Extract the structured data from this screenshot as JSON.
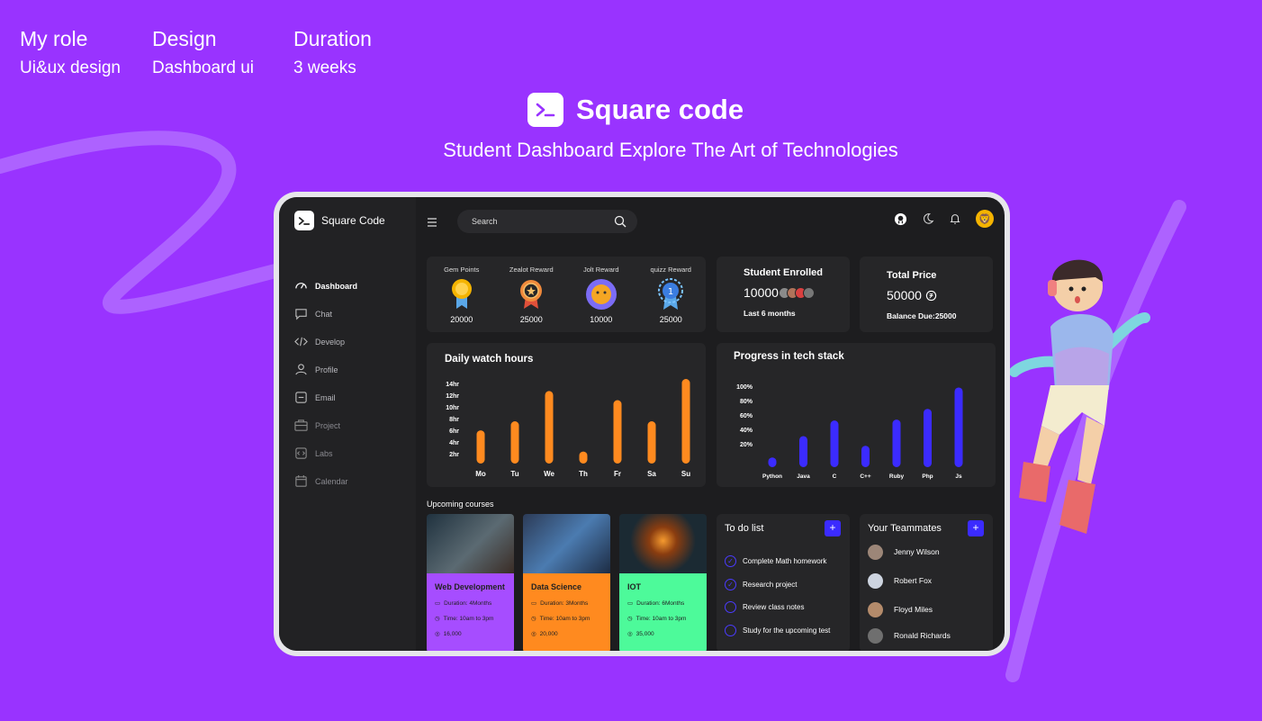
{
  "project_meta": [
    {
      "key": "My role",
      "value": "Ui&ux design"
    },
    {
      "key": "Design",
      "value": "Dashboard ui"
    },
    {
      "key": "Duration",
      "value": "3 weeks"
    }
  ],
  "brand": {
    "name": "Square code",
    "subtitle": "Student Dashboard Explore The Art of Technologies"
  },
  "colors": {
    "background": "#9933ff",
    "accent_orange": "#ff8a1f",
    "accent_blue": "#3b2bff",
    "panel": "#262628"
  },
  "dashboard": {
    "app_name": "Square Code",
    "search_placeholder": "Search",
    "nav": [
      {
        "label": "Dashboard",
        "icon": "gauge-icon",
        "active": true
      },
      {
        "label": "Chat",
        "icon": "chat-icon"
      },
      {
        "label": "Develop",
        "icon": "code-icon"
      },
      {
        "label": "Profile",
        "icon": "user-icon"
      },
      {
        "label": "Email",
        "icon": "email-icon"
      },
      {
        "label": "Project",
        "icon": "briefcase-icon"
      },
      {
        "label": "Labs",
        "icon": "labs-icon"
      },
      {
        "label": "Calendar",
        "icon": "calendar-icon"
      }
    ],
    "rewards": [
      {
        "label": "Gem Points",
        "value": "20000"
      },
      {
        "label": "Zealot Reward",
        "value": "25000"
      },
      {
        "label": "Jolt Reward",
        "value": "10000"
      },
      {
        "label": "quizz Reward",
        "value": "25000"
      }
    ],
    "enrolled": {
      "title": "Student Enrolled",
      "value": "10000",
      "sub": "Last 6 months"
    },
    "price": {
      "title": "Total Price",
      "value": "50000",
      "sub": "Balance Due:25000"
    },
    "watch_title": "Daily watch hours",
    "progress_title": "Progress in tech  stack",
    "courses_title": "Upcoming courses",
    "courses": [
      {
        "name": "Web Development",
        "duration": "Duration: 4Months",
        "time": "Time: 10am to 3pm",
        "price": "16,000",
        "color": "#a64dff"
      },
      {
        "name": "Data Science",
        "duration": "Duration: 3Months",
        "time": "Time: 10am to 3pm",
        "price": "20,000",
        "color": "#ff8a1f"
      },
      {
        "name": "IOT",
        "duration": "Duration: 6Months",
        "time": "Time: 10am to 3pm",
        "price": "35,000",
        "color": "#4dfa9a"
      }
    ],
    "todo_title": "To do list",
    "todos": [
      "Complete Math homework",
      "Research project",
      "Review class notes",
      "Study for the upcoming test"
    ],
    "team_title": "Your Teammates",
    "team": [
      "Jenny Wilson",
      "Robert Fox",
      "Floyd Miles",
      "Ronald Richards"
    ]
  },
  "chart_data": [
    {
      "type": "bar",
      "title": "Daily watch hours",
      "categories": [
        "Mo",
        "Tu",
        "We",
        "Th",
        "Fr",
        "Sa",
        "Su"
      ],
      "values": [
        5.5,
        7,
        12,
        2,
        10.5,
        7,
        14
      ],
      "y_ticks": [
        "14hr",
        "12hr",
        "10hr",
        "8hr",
        "6hr",
        "4hr",
        "2hr"
      ],
      "ylim": [
        0,
        14
      ],
      "color": "#ff8a1f"
    },
    {
      "type": "bar",
      "title": "Progress in tech  stack",
      "categories": [
        "Python",
        "Java",
        "C",
        "C++",
        "Ruby",
        "Php",
        "Js"
      ],
      "values": [
        10,
        32,
        48,
        22,
        49,
        60,
        82
      ],
      "y_ticks": [
        "100%",
        "80%",
        "60%",
        "40%",
        "20%"
      ],
      "ylim": [
        0,
        100
      ],
      "color": "#3b2bff"
    }
  ]
}
